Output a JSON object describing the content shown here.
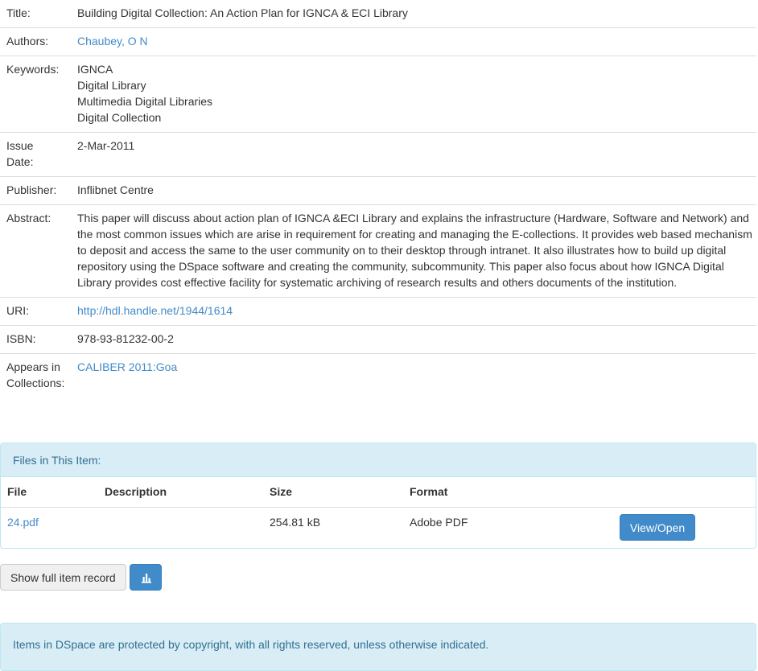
{
  "metadata": {
    "title": {
      "label": "Title:",
      "value": "Building Digital Collection: An Action Plan for IGNCA & ECI Library"
    },
    "authors": {
      "label": "Authors:",
      "value": "Chaubey, O N"
    },
    "keywords": {
      "label": "Keywords:",
      "values": [
        "IGNCA",
        "Digital Library",
        "Multimedia Digital Libraries",
        "Digital Collection"
      ]
    },
    "issue_date": {
      "label_line1": "Issue",
      "label_line2": "Date:",
      "value": "2-Mar-2011"
    },
    "publisher": {
      "label": "Publisher:",
      "value": "Inflibnet Centre"
    },
    "abstract": {
      "label": "Abstract:",
      "value": "This paper will discuss about action plan of IGNCA &ECI Library and explains the infrastructure (Hardware, Software and Network) and the most common issues which are arise in requirement for creating and managing the E-collections. It provides web based mechanism to deposit and access the same to the user community on to their desktop through intranet. It also illustrates how to build up digital repository using the DSpace software and creating the community, subcommunity.  This paper also focus about how IGNCA Digital Library provides cost effective facility for systematic archiving of research results and others documents of the institution."
    },
    "uri": {
      "label": "URI:",
      "value": "http://hdl.handle.net/1944/1614"
    },
    "isbn": {
      "label": "ISBN:",
      "value": "978-93-81232-00-2"
    },
    "collections": {
      "label_line1": "Appears in",
      "label_line2": "Collections:",
      "value": "CALIBER 2011:Goa"
    }
  },
  "files_panel": {
    "heading": "Files in This Item:",
    "columns": [
      "File",
      "Description",
      "Size",
      "Format"
    ],
    "rows": [
      {
        "file": "24.pdf",
        "description": "",
        "size": "254.81 kB",
        "format": "Adobe PDF",
        "action": "View/Open"
      }
    ]
  },
  "actions": {
    "full_record": "Show full item record",
    "stats_icon": "bar-chart-icon"
  },
  "footer": {
    "copyright": "Items in DSpace are protected by copyright, with all rights reserved, unless otherwise indicated."
  },
  "colors": {
    "link": "#428bca",
    "info_bg": "#d9edf7",
    "info_border": "#bce8f1",
    "info_text": "#31708f",
    "primary": "#428bca"
  }
}
